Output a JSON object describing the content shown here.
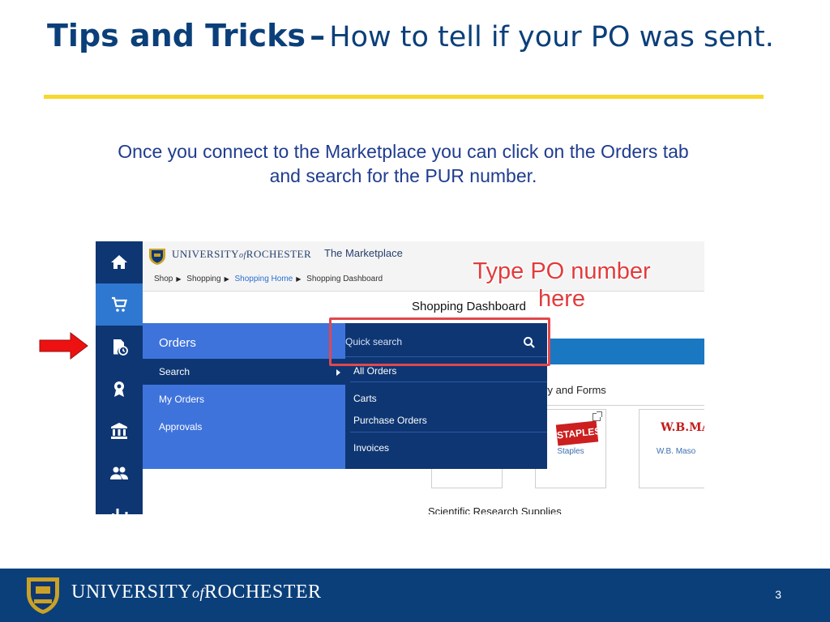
{
  "slide": {
    "title_bold": "Tips and Tricks",
    "title_dash": "–",
    "title_rest": "How to tell if your PO was sent.",
    "subtitle_line1": "Once you connect to the Marketplace you can click on the Orders tab",
    "subtitle_line2": "and search for the PUR number.",
    "page_number": "3",
    "footer_brand_pre": "UNIVERSITY",
    "footer_brand_of": "of",
    "footer_brand_post": "ROCHESTER",
    "accent_color": "#f7d82c",
    "primary_color": "#0b3f7a"
  },
  "app": {
    "brand_pre": "UNIVERSITY",
    "brand_of": "of",
    "brand_post": "ROCHESTER",
    "marketplace": "The Marketplace",
    "breadcrumb": [
      "Shop",
      "Shopping",
      "Shopping Home",
      "Shopping Dashboard"
    ],
    "dashboard_title": "Shopping Dashboard",
    "forms_label": "ery and Forms",
    "science_label": "Scientific Research Supplies",
    "nav_icons": [
      "home-icon",
      "cart-icon",
      "orders-icon",
      "award-icon",
      "bank-icon",
      "people-icon",
      "chart-icon"
    ],
    "orders_menu": {
      "heading": "Orders",
      "items": [
        "Search",
        "My Orders",
        "Approvals"
      ]
    },
    "sub_menu": {
      "search_placeholder": "Quick search",
      "items": [
        "All Orders",
        "Carts",
        "Purchase Orders",
        "Invoices"
      ]
    },
    "suppliers": [
      {
        "logo": "STAPLES",
        "label": "Staples"
      },
      {
        "logo": "W.B.MASON",
        "label": "W.B. Maso"
      }
    ]
  },
  "annotation": {
    "callout_line1": "Type PO number",
    "callout_line2": "here",
    "callout_color": "#e23c3c"
  }
}
